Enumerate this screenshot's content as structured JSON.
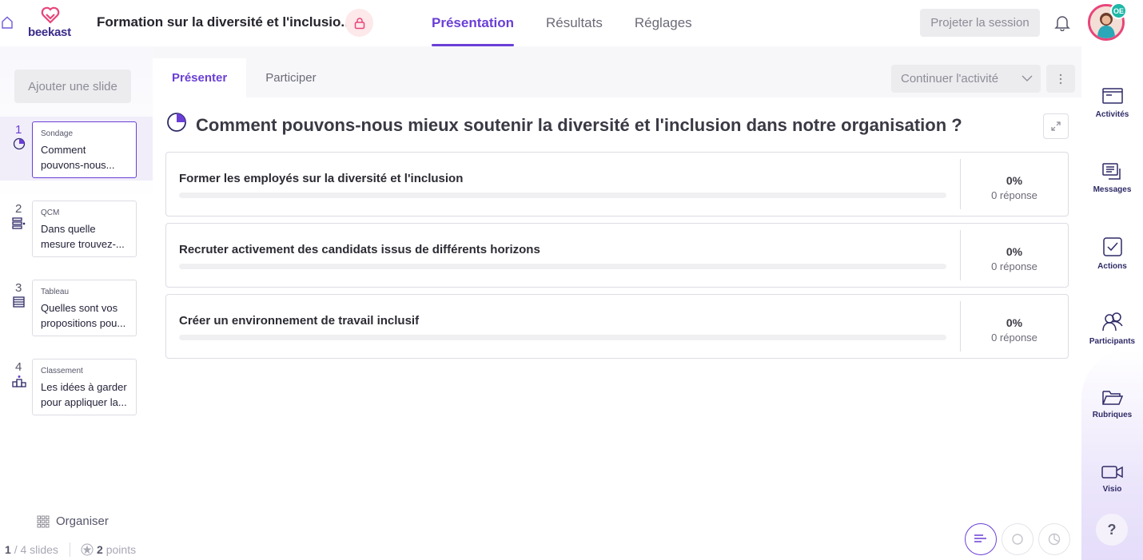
{
  "app": {
    "logo_text": "beekast",
    "title": "Formation sur la diversité et l'inclusio...",
    "tabs": [
      {
        "label": "Présentation",
        "active": true
      },
      {
        "label": "Résultats",
        "active": false
      },
      {
        "label": "Réglages",
        "active": false
      }
    ],
    "project_button": "Projeter la session",
    "avatar_initials": "OE"
  },
  "sidebar": {
    "add_slide": "Ajouter une slide",
    "slides": [
      {
        "num": "1",
        "type": "Sondage",
        "text": "Comment pouvons-nous...",
        "icon": "pie-chart-icon",
        "active": true
      },
      {
        "num": "2",
        "type": "QCM",
        "text": "Dans quelle mesure trouvez-...",
        "icon": "checklist-icon",
        "active": false
      },
      {
        "num": "3",
        "type": "Tableau",
        "text": "Quelles sont vos propositions pou...",
        "icon": "table-icon",
        "active": false
      },
      {
        "num": "4",
        "type": "Classement",
        "text": "Les idées à garder pour appliquer la...",
        "icon": "podium-icon",
        "active": false
      }
    ],
    "organiser": "Organiser",
    "current_slide": "1",
    "total_slides": "/ 4 slides",
    "points_value": "2",
    "points_label": "points"
  },
  "content": {
    "subtabs": [
      {
        "label": "Présenter",
        "active": true
      },
      {
        "label": "Participer",
        "active": false
      }
    ],
    "continue_button": "Continuer l'activité",
    "question": "Comment pouvons-nous mieux soutenir la diversité et l'inclusion dans notre organisation ?",
    "options": [
      {
        "label": "Former les employés sur la diversité et l'inclusion",
        "percent": "0%",
        "responses": "0 réponse",
        "fill": 0
      },
      {
        "label": "Recruter activement des candidats issus de différents horizons",
        "percent": "0%",
        "responses": "0 réponse",
        "fill": 0
      },
      {
        "label": "Créer un environnement de travail inclusif",
        "percent": "0%",
        "responses": "0 réponse",
        "fill": 0
      }
    ]
  },
  "right_sidebar": {
    "items": [
      {
        "label": "Activités",
        "icon": "activities-icon"
      },
      {
        "label": "Messages",
        "icon": "messages-icon"
      },
      {
        "label": "Actions",
        "icon": "actions-icon"
      },
      {
        "label": "Participants",
        "icon": "participants-icon"
      },
      {
        "label": "Rubriques",
        "icon": "folder-icon"
      },
      {
        "label": "Visio",
        "icon": "video-icon"
      }
    ],
    "help": "?"
  },
  "colors": {
    "accent": "#6a3fd6",
    "navy": "#2e2a66",
    "brand_red": "#e8457a"
  }
}
